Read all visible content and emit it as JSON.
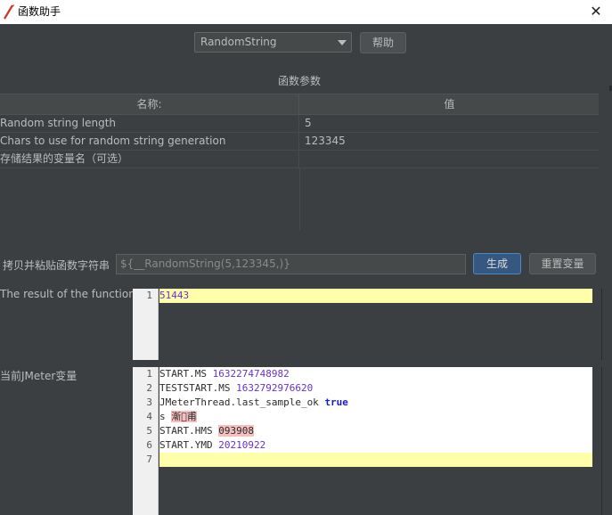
{
  "window": {
    "title": "函数助手",
    "close_glyph": "✕"
  },
  "toolbar": {
    "function_selected": "RandomString",
    "help_label": "帮助"
  },
  "params": {
    "section_title": "函数参数",
    "headers": {
      "name": "名称:",
      "value": "值"
    },
    "rows": [
      {
        "name": "Random string length",
        "value": "5"
      },
      {
        "name": "Chars to use for random string generation",
        "value": "123345"
      },
      {
        "name": "存储结果的变量名（可选）",
        "value": ""
      }
    ]
  },
  "copy": {
    "label": "拷贝并粘贴函数字符串",
    "value": "${__RandomString(5,123345,)}",
    "generate_label": "生成",
    "reset_label": "重置变量"
  },
  "result": {
    "label": "The result of the function is",
    "lines": [
      {
        "no": "1",
        "text": "51443"
      }
    ]
  },
  "variables": {
    "label": "当前JMeter变量",
    "lines": [
      {
        "no": "1",
        "key": "START.MS",
        "value": "1632274748982"
      },
      {
        "no": "2",
        "key": "TESTSTART.MS",
        "value": "1632792976620"
      },
      {
        "no": "3",
        "key": "JMeterThread.last_sample_ok",
        "value": "true"
      },
      {
        "no": "4",
        "key": "s",
        "value": "漸\u0000甫"
      },
      {
        "no": "5",
        "key": "START.HMS",
        "value": "093908"
      },
      {
        "no": "6",
        "key": "START.YMD",
        "value": "20210922"
      },
      {
        "no": "7",
        "key": "",
        "value": ""
      }
    ]
  },
  "icons": {
    "app": "feather-icon",
    "close": "close-icon",
    "dropdown": "chevron-down-icon"
  }
}
